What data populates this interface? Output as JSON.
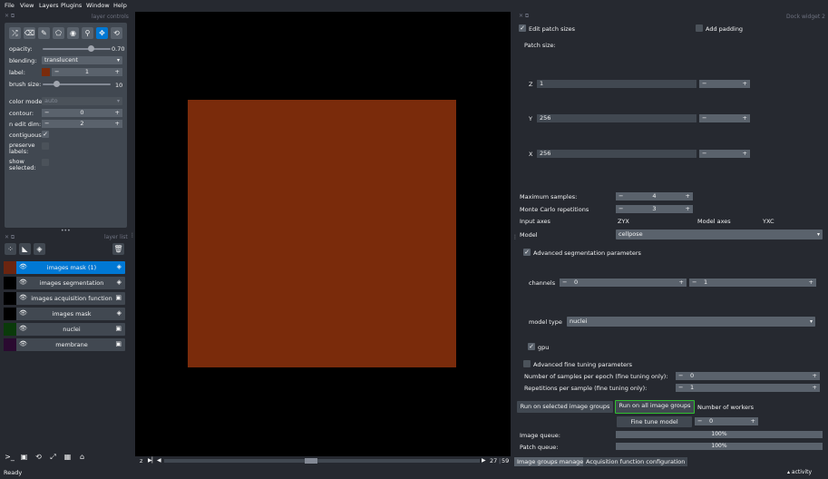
{
  "menubar": {
    "items": [
      "File",
      "View",
      "Layers",
      "Plugins",
      "Window",
      "Help"
    ]
  },
  "layer_controls": {
    "title": "layer controls",
    "opacity_label": "opacity:",
    "opacity_value": "0.70",
    "opacity_fraction": 0.7,
    "blending_label": "blending:",
    "blending_value": "translucent",
    "label_label": "label:",
    "label_value": "1",
    "label_color": "#7a2b0b",
    "brush_label": "brush size:",
    "brush_value": "10",
    "brush_fraction": 0.2,
    "colormode_label": "color mode:",
    "colormode_value": "auto",
    "contour_label": "contour:",
    "contour_value": "0",
    "nedit_label": "n edit dim:",
    "nedit_value": "2",
    "contiguous_label": "contiguous:",
    "contiguous_checked": "✓",
    "preserve_label_1": "preserve",
    "preserve_label_2": "labels:",
    "show_label_1": "show",
    "show_label_2": "selected:",
    "tools": [
      "shuffle-icon",
      "eraser-icon",
      "pencil-icon",
      "polygon-icon",
      "fill-icon",
      "picker-icon",
      "pan-icon",
      "transform-icon"
    ]
  },
  "layer_list": {
    "title": "layer list",
    "layers": [
      {
        "name": "images mask (1)",
        "type_icon": "◈",
        "selected": true,
        "thumb": "#6b2510"
      },
      {
        "name": "images segmentation",
        "type_icon": "◈",
        "selected": false,
        "thumb": "#000000"
      },
      {
        "name": "images acquisition function",
        "type_icon": "▣",
        "selected": false,
        "thumb": "#000000"
      },
      {
        "name": "images mask",
        "type_icon": "◈",
        "selected": false,
        "thumb": "#000000"
      },
      {
        "name": "nuclei",
        "type_icon": "▣",
        "selected": false,
        "thumb": "#0a3a0a"
      },
      {
        "name": "membrane",
        "type_icon": "▣",
        "selected": false,
        "thumb": "#2a0a30"
      }
    ]
  },
  "dims": {
    "axis_label": "z",
    "current": "27",
    "total": "59"
  },
  "status": {
    "left": "Ready",
    "right": "activity"
  },
  "dock": {
    "title": "Dock widget 2",
    "edit_patch_sizes": "Edit patch sizes",
    "add_padding": "Add padding",
    "patch_size_label": "Patch size:",
    "patch": [
      {
        "axis": "Z",
        "value": "1"
      },
      {
        "axis": "Y",
        "value": "256"
      },
      {
        "axis": "X",
        "value": "256"
      }
    ],
    "max_samples_label": "Maximum samples:",
    "max_samples_value": "4",
    "mc_label": "Monte Carlo repetitions",
    "mc_value": "3",
    "input_axes_label": "Input axes",
    "input_axes_value": "ZYX",
    "model_axes_label": "Model axes",
    "model_axes_value": "YXC",
    "model_label": "Model",
    "model_value": "cellpose",
    "adv_seg_label": "Advanced segmentation parameters",
    "channels_label": "channels",
    "channel_1": "0",
    "channel_2": "1",
    "model_type_label": "model type",
    "model_type_value": "nuclei",
    "gpu_label": "gpu",
    "adv_ft_label": "Advanced fine tuning parameters",
    "ft_samples_label": "Number of samples per epoch (fine tuning only):",
    "ft_samples_value": "0",
    "ft_reps_label": "Repetitions per sample (fine tuning only):",
    "ft_reps_value": "1",
    "run_selected": "Run on selected image groups",
    "run_all": "Run on all image groups",
    "workers_label": "Number of workers",
    "fine_tune": "Fine tune model",
    "workers_value": "0",
    "image_queue_label": "Image queue:",
    "image_queue_value": "100%",
    "patch_queue_label": "Patch queue:",
    "patch_queue_value": "100%"
  },
  "tabs": [
    "Image groups manager",
    "Acquisition function configuration"
  ]
}
